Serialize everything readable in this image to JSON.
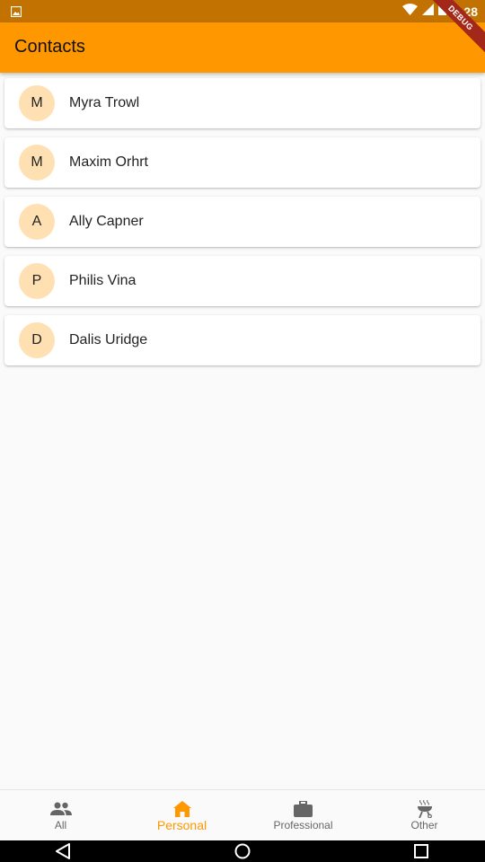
{
  "status_bar": {
    "time": "4:28",
    "icons": [
      "image-icon",
      "wifi-icon",
      "signal-icon",
      "battery-icon"
    ]
  },
  "app_bar": {
    "title": "Contacts",
    "debug_banner": "DEBUG",
    "color": "#ff9800"
  },
  "contacts": [
    {
      "initial": "M",
      "name": "Myra Trowl"
    },
    {
      "initial": "M",
      "name": "Maxim Orhrt"
    },
    {
      "initial": "A",
      "name": "Ally Capner"
    },
    {
      "initial": "P",
      "name": "Philis Vina"
    },
    {
      "initial": "D",
      "name": "Dalis Uridge"
    }
  ],
  "bottom_nav": {
    "items": [
      {
        "label": "All",
        "icon": "people-icon",
        "active": false
      },
      {
        "label": "Personal",
        "icon": "home-icon",
        "active": true
      },
      {
        "label": "Professional",
        "icon": "briefcase-icon",
        "active": false
      },
      {
        "label": "Other",
        "icon": "grill-icon",
        "active": false
      }
    ],
    "active_color": "#ff9800"
  },
  "system_nav": {
    "buttons": [
      "back-icon",
      "home-circle-icon",
      "recents-icon"
    ]
  }
}
